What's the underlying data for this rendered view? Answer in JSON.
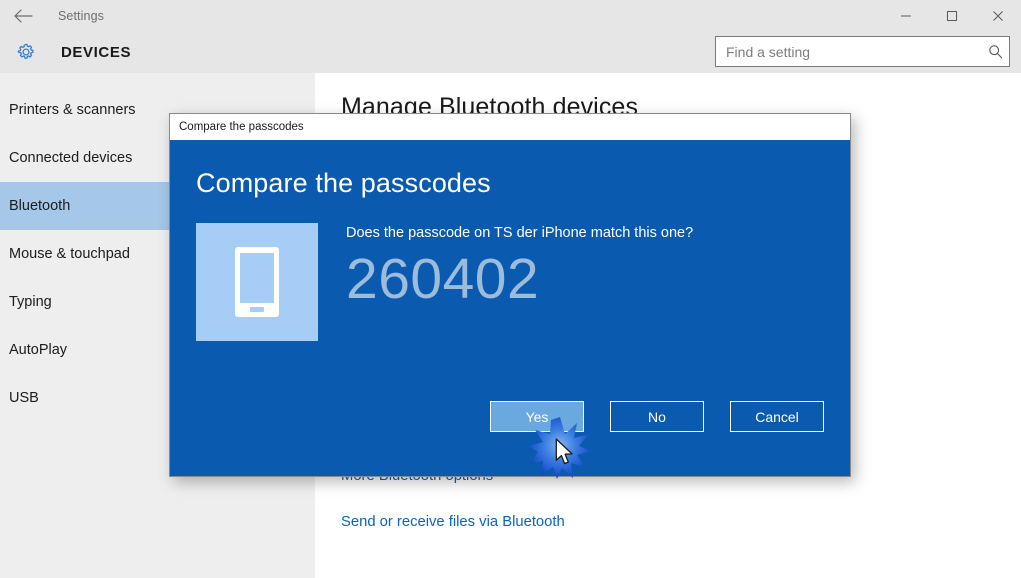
{
  "window": {
    "app_title": "Settings",
    "back_icon": "back-arrow-icon",
    "minimize_label": "—",
    "maximize_label": "□",
    "close_label": "✕"
  },
  "header": {
    "icon": "gear-icon",
    "title": "DEVICES",
    "search": {
      "placeholder": "Find a setting",
      "value": "",
      "icon": "search-icon"
    }
  },
  "sidebar": {
    "items": [
      {
        "label": "Printers & scanners",
        "selected": false
      },
      {
        "label": "Connected devices",
        "selected": false
      },
      {
        "label": "Bluetooth",
        "selected": true
      },
      {
        "label": "Mouse & touchpad",
        "selected": false
      },
      {
        "label": "Typing",
        "selected": false
      },
      {
        "label": "AutoPlay",
        "selected": false
      },
      {
        "label": "USB",
        "selected": false
      }
    ],
    "selected_bg": "#a5c8e8"
  },
  "content": {
    "heading": "Manage Bluetooth devices",
    "links": [
      {
        "label": "More Bluetooth options"
      },
      {
        "label": "Send or receive files via Bluetooth"
      }
    ],
    "link_color": "#0a64c2"
  },
  "dialog": {
    "titlebar_text": "Compare the passcodes",
    "heading": "Compare the passcodes",
    "device_icon": "phone-icon",
    "question": "Does the passcode on TS der iPhone match this one?",
    "passcode": "260402",
    "buttons": [
      {
        "label": "Yes",
        "highlight": true
      },
      {
        "label": "No",
        "highlight": false
      },
      {
        "label": "Cancel",
        "highlight": false
      }
    ],
    "background_color": "#0a5ab0",
    "tile_color": "#a6cdf5",
    "passcode_color": "#9dbcdb",
    "highlight_button_color": "#6aa9e0"
  },
  "pointer": {
    "click_indicator": "click-burst-icon",
    "cursor": "arrow-cursor-icon"
  }
}
